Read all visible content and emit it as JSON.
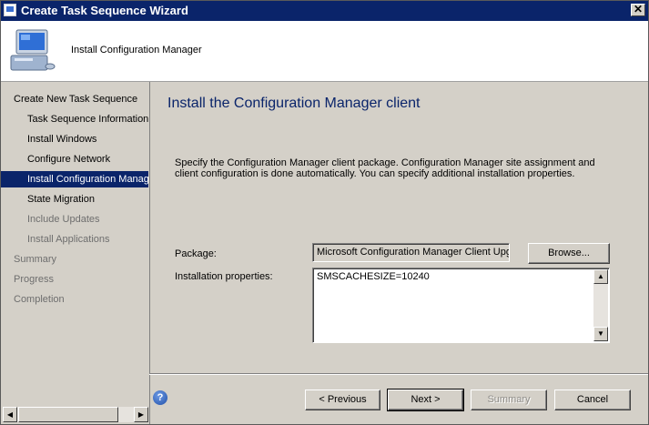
{
  "window": {
    "title": "Create Task Sequence Wizard",
    "close_glyph": "✕"
  },
  "header": {
    "title": "Install Configuration Manager",
    "icon": "computer-icon"
  },
  "sidebar": {
    "items": [
      {
        "label": "Create New Task Sequence",
        "level": 0,
        "state": "normal"
      },
      {
        "label": "Task Sequence Information",
        "level": 1,
        "state": "normal"
      },
      {
        "label": "Install Windows",
        "level": 1,
        "state": "normal"
      },
      {
        "label": "Configure Network",
        "level": 1,
        "state": "normal"
      },
      {
        "label": "Install Configuration Manager",
        "level": 1,
        "state": "selected"
      },
      {
        "label": "State Migration",
        "level": 1,
        "state": "normal"
      },
      {
        "label": "Include Updates",
        "level": 1,
        "state": "disabled"
      },
      {
        "label": "Install Applications",
        "level": 1,
        "state": "disabled"
      },
      {
        "label": "Summary",
        "level": 0,
        "state": "disabled"
      },
      {
        "label": "Progress",
        "level": 0,
        "state": "disabled"
      },
      {
        "label": "Completion",
        "level": 0,
        "state": "disabled"
      }
    ],
    "scroll_left_glyph": "◀",
    "scroll_right_glyph": "▶"
  },
  "main": {
    "title": "Install the Configuration Manager client",
    "description": "Specify the Configuration Manager client package. Configuration Manager site assignment and client configuration is done automatically. You can specify additional installation properties.",
    "package_label": "Package:",
    "package_value": "Microsoft Configuration Manager Client Upgrade",
    "browse_label": "Browse...",
    "properties_label": "Installation properties:",
    "properties_value": "SMSCACHESIZE=10240",
    "scroll_up_glyph": "▲",
    "scroll_down_glyph": "▼"
  },
  "footer": {
    "help_glyph": "?",
    "previous_label": "< Previous",
    "next_label": "Next >",
    "summary_label": "Summary",
    "cancel_label": "Cancel"
  },
  "colors": {
    "titlebar": "#0a246a",
    "selection": "#0a246a",
    "title_text": "#0a246a"
  }
}
